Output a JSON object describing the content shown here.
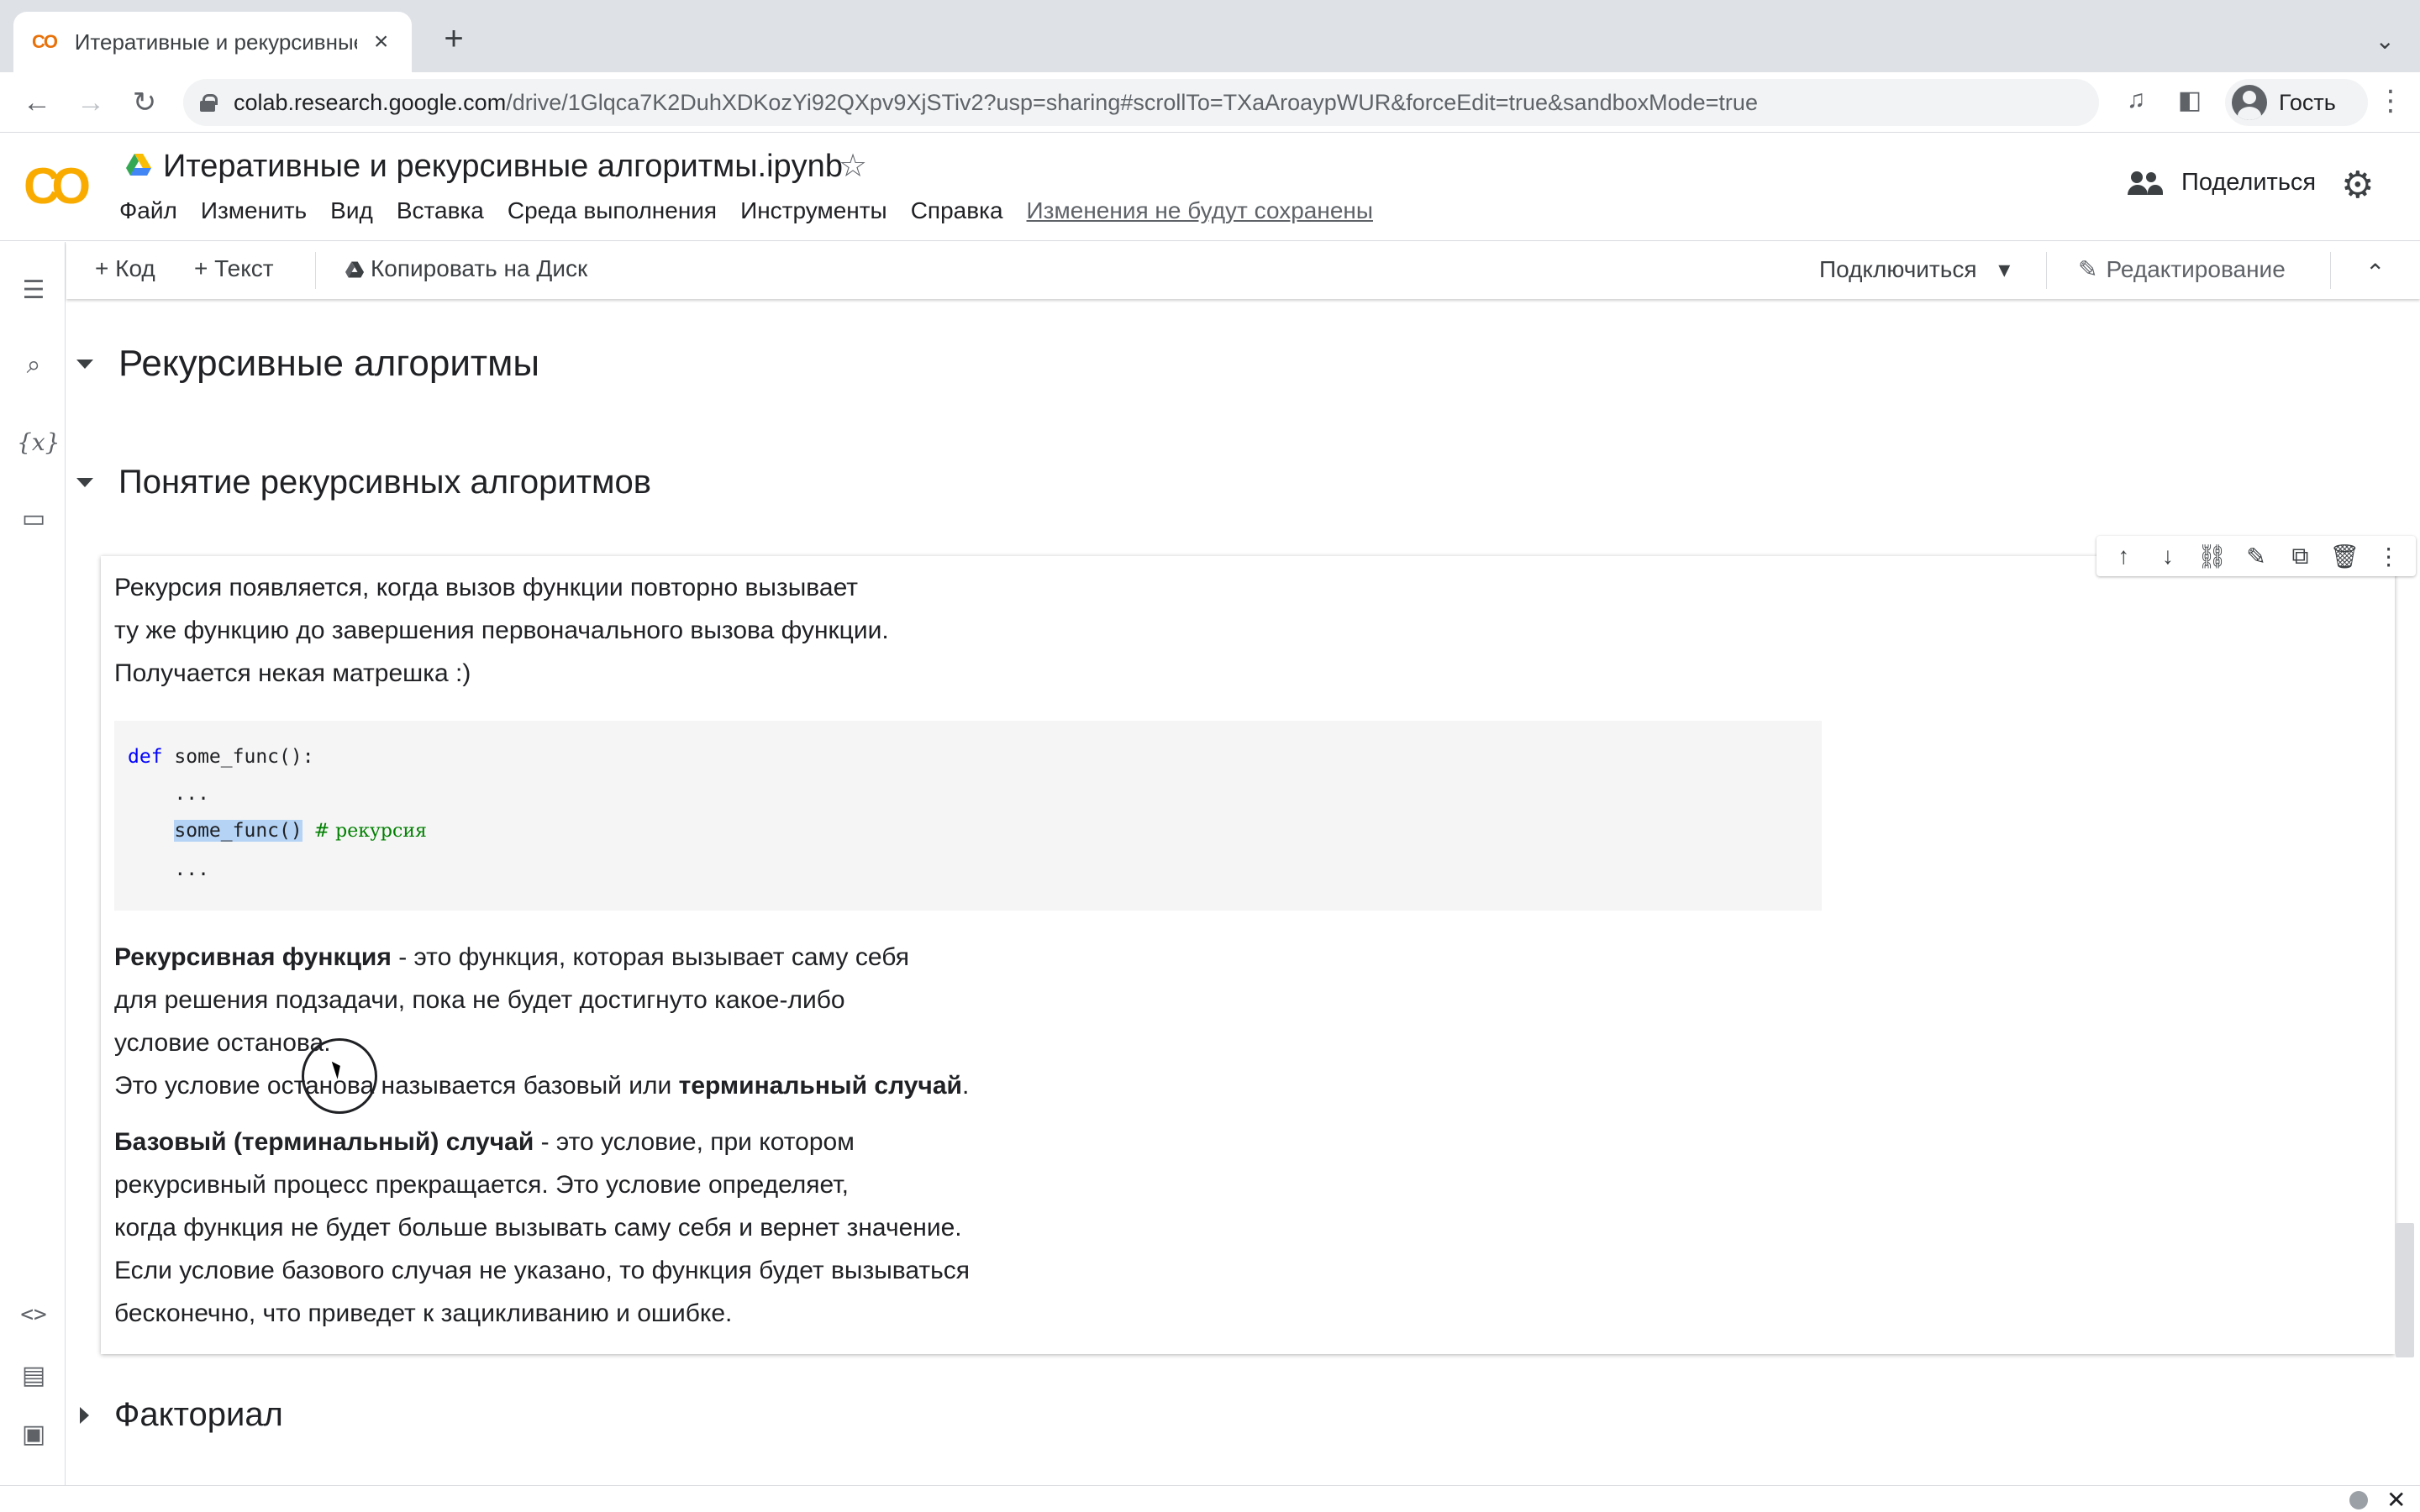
{
  "browser": {
    "tab_title": "Итеративные и рекурсивные",
    "tab_favicon": "CO",
    "tab_close": "×",
    "new_tab": "+",
    "url_host": "colab.research.google.com",
    "url_path": "/drive/1Glqca7K2DuhXDKozYi92QXpv9XjSTiv2?usp=sharing#scrollTo=TXaAroaypWUR&forceEdit=true&sandboxMode=true",
    "profile_name": "Гость",
    "icons": {
      "back": "←",
      "forward": "→",
      "reload": "↻",
      "tab_search": "⌄",
      "media": "♫",
      "sidepanel": "◧",
      "menu": "⋮"
    }
  },
  "colab": {
    "logo": "CO",
    "notebook_title": "Итеративные и рекурсивные алгоритмы.ipynb",
    "star": "☆",
    "menu": [
      "Файл",
      "Изменить",
      "Вид",
      "Вставка",
      "Среда выполнения",
      "Инструменты",
      "Справка"
    ],
    "unsaved_notice": "Изменения не будут сохранены",
    "share_label": "Поделиться",
    "settings_icon": "⚙"
  },
  "cell_toolbar": {
    "add_code": "+ Код",
    "add_text": "+ Текст",
    "copy_to_drive": "Копировать на Диск",
    "connect": "Подключиться",
    "connect_arrow": "▾",
    "editing": "Редактирование",
    "collapse": "⌃"
  },
  "left_rail": {
    "toc": "☰",
    "search": "⌕",
    "variables": "{x}",
    "files": "▭",
    "snippets": "<>",
    "command_palette": "▤",
    "terminal": "▣"
  },
  "notebook": {
    "section_recursive": "Рекурсивные алгоритмы",
    "section_concept": "Понятие рекурсивных алгоритмов",
    "section_factorial": "Факториал",
    "cell_tools": [
      "↑",
      "↓",
      "⛓",
      "✎",
      "⧉",
      "🗑",
      "⋮"
    ],
    "intro": [
      "Рекурсия появляется, когда вызов функции повторно вызывает",
      "ту же функцию до завершения первоначального вызова функции.",
      "Получается некая матрешка :)"
    ],
    "code": {
      "line1_kw": "def",
      "line1_rest": " some_func():",
      "line2": "    ...",
      "line3_indent": "    ",
      "line3_call": "some_func()",
      "line3_comment": "  # рекурсия",
      "line4": "    ..."
    },
    "recursive_def_bold": "Рекурсивная функция",
    "recursive_def_rest": " - это функция, которая вызывает саму себя",
    "recursive_lines": [
      "для решения подзадачи, пока не будет достигнуто какое-либо",
      "условие останова."
    ],
    "stop_text": "Это условие останова называется базовый или ",
    "stop_bold": "терминальный случай",
    "stop_end": ".",
    "base_bold": "Базовый (терминальный) случай",
    "base_rest": " - это условие, при котором",
    "base_lines": [
      "рекурсивный процесс прекращается. Это условие определяет,",
      "когда функция не будет больше вызывать саму себя и вернет значение.",
      "Если условие базового случая не указано, то функция будет вызываться",
      "бесконечно, что приведет к зацикливанию и ошибке."
    ]
  },
  "status": {
    "close": "✕"
  }
}
